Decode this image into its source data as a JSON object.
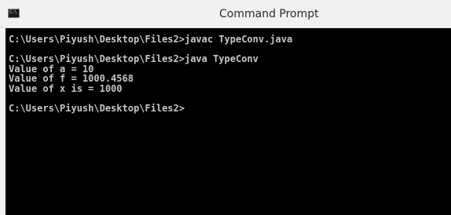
{
  "window": {
    "title": "Command Prompt",
    "icon": "cmd-app-icon",
    "icon_glyph": "C:\\"
  },
  "console": {
    "lines": [
      "C:\\Users\\Piyush\\Desktop\\Files2>javac TypeConv.java",
      "",
      "C:\\Users\\Piyush\\Desktop\\Files2>java TypeConv",
      "Value of a = 10",
      "Value of f = 1000.4568",
      "Value of x is = 1000",
      "",
      "C:\\Users\\Piyush\\Desktop\\Files2>"
    ],
    "colors": {
      "background": "#000000",
      "text": "#c6c6c6"
    }
  }
}
